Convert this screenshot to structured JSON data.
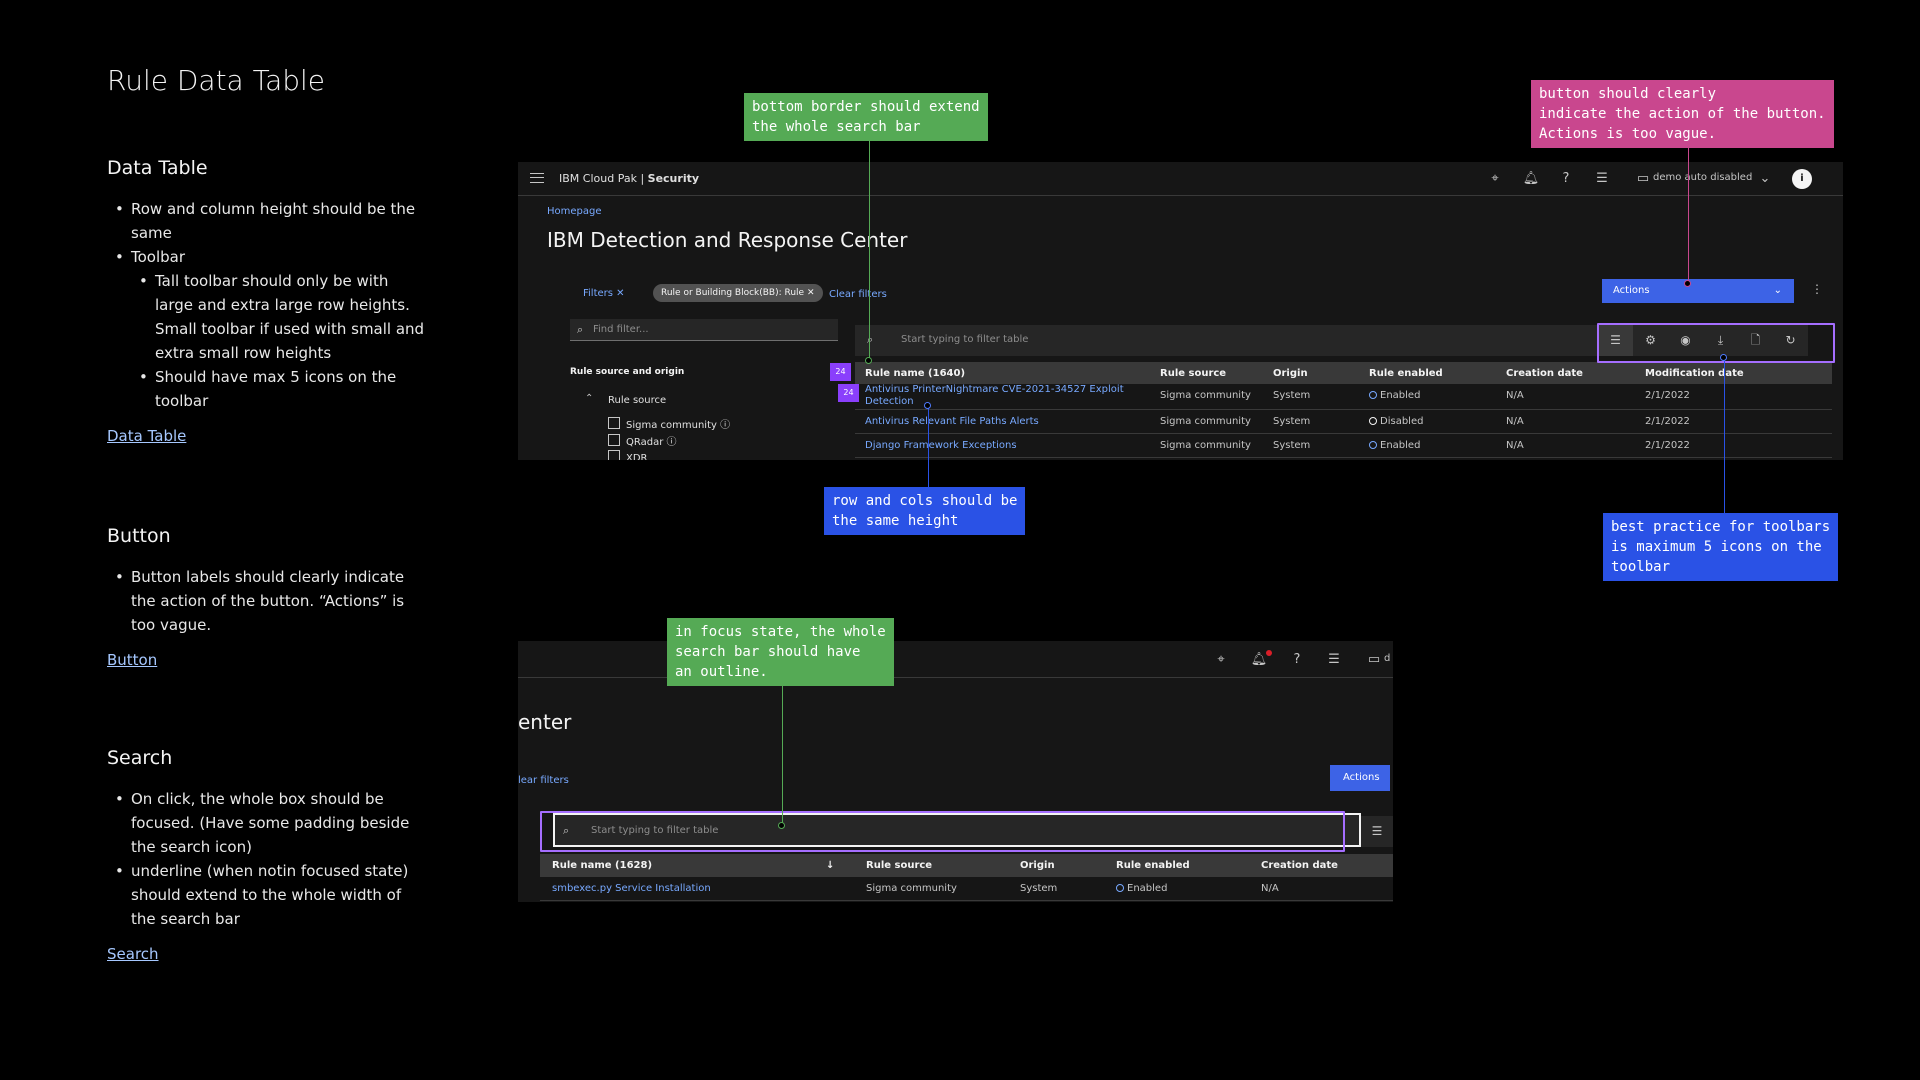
{
  "notes": {
    "title": "Rule Data Table",
    "sections": [
      {
        "heading": "Data Table",
        "bullets": [
          "Row and column height should be the same",
          "Toolbar",
          "Tall toolbar should only be with large and extra large row heights. Small toolbar if used with small and extra small row heights",
          "Should have max 5 icons on the toolbar"
        ],
        "link": "Data Table"
      },
      {
        "heading": "Button",
        "bullets": [
          "Button labels should clearly indicate the action of the button. “Actions” is too vague."
        ],
        "link": "Button"
      },
      {
        "heading": "Search",
        "bullets": [
          "On click, the whole box should be focused. (Have some padding beside the search icon)",
          "underline (when notin focused state) should extend to the whole width of the search bar"
        ],
        "link": "Search"
      }
    ]
  },
  "shot1": {
    "brand_prefix": "IBM Cloud Pak | ",
    "brand_suffix": "Security",
    "tenant": "demo auto disabled",
    "avatar": "i",
    "breadcrumb": "Homepage",
    "page_title": "IBM Detection and Response Center",
    "filters_label": "Filters",
    "filter_chip": "Rule or Building Block(BB): Rule",
    "clear_filters": "Clear filters",
    "find_placeholder": "Find filter...",
    "filter_group": "Rule source and origin",
    "filter_source": "Rule source",
    "checkboxes": [
      "Sigma community",
      "QRadar",
      "XDR"
    ],
    "actions_label": "Actions",
    "search_placeholder": "Start typing to filter table",
    "columns": [
      "Rule name (1640)",
      "Rule source",
      "Origin",
      "Rule enabled",
      "Creation date",
      "Modification date"
    ],
    "badges": [
      "24",
      "24"
    ],
    "rows": [
      {
        "name": "Antivirus PrinterNightmare CVE-2021-34527 Exploit Detection",
        "source": "Sigma community",
        "origin": "System",
        "enabled": "Enabled",
        "created": "N/A",
        "modified": "2/1/2022"
      },
      {
        "name": "Antivirus Relevant File Paths Alerts",
        "source": "Sigma community",
        "origin": "System",
        "enabled": "Disabled",
        "created": "N/A",
        "modified": "2/1/2022"
      },
      {
        "name": "Django Framework Exceptions",
        "source": "Sigma community",
        "origin": "System",
        "enabled": "Enabled",
        "created": "N/A",
        "modified": "2/1/2022"
      }
    ]
  },
  "shot2": {
    "page_title_fragment": "enter",
    "clear_filters_fragment": "lear filters",
    "tenant_fragment": "d",
    "actions_label": "Actions",
    "search_placeholder": "Start typing to filter table",
    "columns": [
      "Rule name (1628)",
      "Rule source",
      "Origin",
      "Rule enabled",
      "Creation date"
    ],
    "rows": [
      {
        "name": "smbexec.py Service Installation",
        "source": "Sigma community",
        "origin": "System",
        "enabled": "Enabled",
        "created": "N/A"
      }
    ]
  },
  "callouts": {
    "search_border": "bottom border should extend\nthe whole search bar",
    "button_action": "button should clearly\nindicate the action of the button.\nActions is too vague.",
    "row_height": "row and cols should be\nthe same height",
    "toolbar_icons": "best practice for toolbars\nis maximum 5 icons on the\ntoolbar",
    "focus_state": "in focus state, the whole\nsearch bar should have\nan outline."
  },
  "colors": {
    "green_callout": "#55aa55",
    "blue_callout": "#2a52e6",
    "pink_callout": "#c9478e",
    "highlight": "#a56eff",
    "primary_button": "#3d63e6",
    "link": "#78a9ff"
  },
  "icons": {
    "header": [
      "menu-icon",
      "launch-icon",
      "notification-icon",
      "help-icon",
      "switcher-icon",
      "workspace-icon",
      "chevron-down-icon",
      "user-avatar"
    ],
    "toolbar": [
      "row-height-icon",
      "settings-icon",
      "view-icon",
      "download-icon",
      "export-icon",
      "refresh-icon"
    ]
  }
}
